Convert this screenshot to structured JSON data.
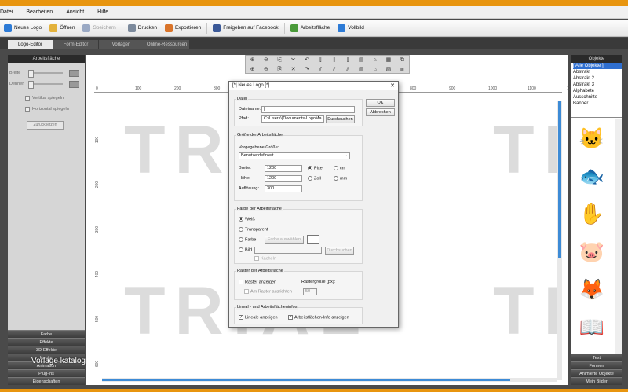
{
  "menu": [
    "Datei",
    "Bearbeiten",
    "Ansicht",
    "Hilfe"
  ],
  "toolbar": [
    {
      "label": "Neues Logo",
      "icon": "new-logo-icon",
      "color": "#2d7bd6",
      "disabled": false
    },
    {
      "label": "Öffnen",
      "icon": "folder-icon",
      "color": "#e3b23c",
      "disabled": false
    },
    {
      "label": "Speichern",
      "icon": "save-icon",
      "color": "#9aa9c4",
      "disabled": true
    },
    {
      "label": "Drucken",
      "icon": "printer-icon",
      "color": "#7c8a9c",
      "disabled": false
    },
    {
      "label": "Exportieren",
      "icon": "export-icon",
      "color": "#d9742a",
      "disabled": false
    },
    {
      "label": "Freigeben auf Facebook",
      "icon": "facebook-icon",
      "color": "#3b5998",
      "disabled": false
    },
    {
      "label": "Arbeitsfläche",
      "icon": "canvas-icon",
      "color": "#4a9a3a",
      "disabled": false
    },
    {
      "label": "Vollbild",
      "icon": "fullscreen-icon",
      "color": "#2d7bd6",
      "disabled": false
    }
  ],
  "mode_tabs": [
    "Logo-Editor",
    "Form-Editor",
    "Vorlagen",
    "Online-Ressourcen"
  ],
  "left_panel": {
    "title": "Arbeitsfläche",
    "rows": [
      "Breite",
      "Dehnen"
    ],
    "checks": [
      "Vertikal spiegeln",
      "Horizontal spiegeln"
    ],
    "button": "Zurücksetzen",
    "accordion": [
      "Farbe",
      "Effekte",
      "3D-Effekte",
      "Kontur",
      "Animation",
      "Plug-ins",
      "Eigenschaften"
    ]
  },
  "rulers": {
    "h": [
      "0",
      "100",
      "200",
      "300",
      "400",
      "500",
      "600",
      "700",
      "800",
      "900",
      "1000",
      "1100",
      "1200"
    ],
    "v": [
      "100",
      "200",
      "300",
      "400",
      "500",
      "600"
    ]
  },
  "trial_text": "TRIAL",
  "canvas_tools": [
    "⊕",
    "⊖",
    "⎘",
    "✂",
    "↶",
    "⫿",
    "⫿",
    "⫿",
    "▤",
    "⌂",
    "▦",
    "⧉",
    "⊕",
    "⊖",
    "⎘",
    "✕",
    "↷",
    "⫽",
    "⫽",
    "⫽",
    "▥",
    "⌂",
    "▧",
    "⧈"
  ],
  "right_panel": {
    "title": "Objekte",
    "categories": [
      "[ Alle Objekte ]",
      "Abstrakt",
      "Abstrakt 2",
      "Abstrakt 3",
      "Alphabete",
      "Ausschnitte",
      "Banner"
    ],
    "icons": [
      {
        "name": "cat-icon",
        "glyph": "🐱",
        "color": "#e0743a"
      },
      {
        "name": "fish-icon",
        "glyph": "🐟",
        "color": "#2aa6c9"
      },
      {
        "name": "hand-icon",
        "glyph": "✋",
        "color": "#d42a2a"
      },
      {
        "name": "pig-icon",
        "glyph": "🐷",
        "color": "#d93ea6"
      },
      {
        "name": "animal-icon",
        "glyph": "🦊",
        "color": "#c8642a"
      },
      {
        "name": "book-icon",
        "glyph": "📖",
        "color": "#e0a030"
      },
      {
        "name": "chick-icon",
        "glyph": "🐤",
        "color": "#f0c020"
      }
    ],
    "accordion": [
      "Text",
      "Formen",
      "Animierte Objekte",
      "Mein Bilder"
    ]
  },
  "dialog": {
    "title": "[*] Neues Logo [*]",
    "ok": "OK",
    "cancel": "Abbrechen",
    "file_group": "Datei",
    "filename_label": "Dateiname:",
    "filename_value": "|",
    "path_label": "Pfad:",
    "path_value": "C:\\Users\\|Documents\\LogoMa",
    "browse": "Durchsuchen",
    "size_group": "Größe der Arbeitsfläche",
    "preset_label": "Vorgegebene Größe:",
    "preset_value": "Benutzerdefiniert",
    "width_label": "Breite:",
    "width_value": "1200",
    "height_label": "Höhe:",
    "height_value": "1200",
    "res_label": "Auflösung:",
    "res_value": "300",
    "unit_pixel": "Pixel",
    "unit_cm": "cm",
    "unit_zoll": "Zoll",
    "unit_mm": "mm",
    "color_group": "Farbe der Arbeitsfläche",
    "color_white": "Weiß",
    "color_transparent": "Transparent",
    "color_color": "Farbe",
    "color_pick": "Farbe auswählen",
    "color_image": "Bild",
    "image_browse": "Durchsuchen",
    "image_tile": "Kacheln",
    "grid_group": "Raster der Arbeitsfläche",
    "grid_show": "Raster anzeigen",
    "grid_snap": "Am Raster ausrichten",
    "grid_size_label": "Rastergröße (px):",
    "grid_size_value": "50",
    "info_group": "Lineal - und Arbeitsflächeninfos",
    "show_rulers": "Lineale anzeigen",
    "show_info": "Arbeitsflächen-Info anzeigen"
  },
  "watermark": "Vorlage katalog"
}
